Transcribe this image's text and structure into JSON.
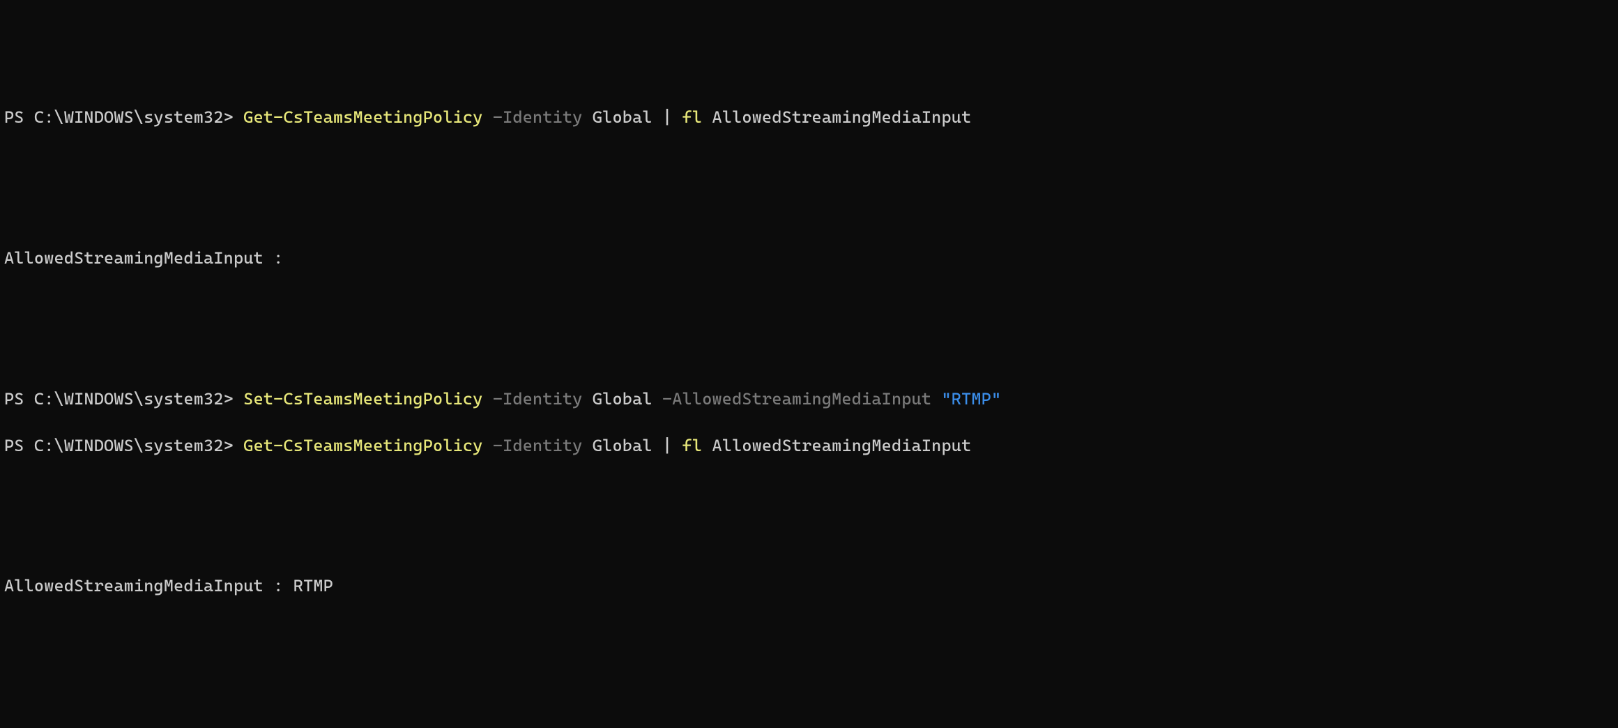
{
  "lines": {
    "l1": {
      "prompt": "PS C:\\WINDOWS\\system32> ",
      "cmdlet": "Get-CsTeamsMeetingPolicy",
      "param1": " -Identity",
      "arg1": " Global ",
      "pipe": "|",
      "fl": " fl ",
      "prop": "AllowedStreamingMediaInput"
    },
    "out1": "AllowedStreamingMediaInput :",
    "l2": {
      "prompt": "PS C:\\WINDOWS\\system32> ",
      "cmdlet": "Set-CsTeamsMeetingPolicy",
      "param1": " -Identity",
      "arg1": " Global",
      "param2": " -AllowedStreamingMediaInput ",
      "string": "\"RTMP\""
    },
    "l3": {
      "prompt": "PS C:\\WINDOWS\\system32> ",
      "cmdlet": "Get-CsTeamsMeetingPolicy",
      "param1": " -Identity",
      "arg1": " Global ",
      "pipe": "|",
      "fl": " fl ",
      "prop": "AllowedStreamingMediaInput"
    },
    "out2": "AllowedStreamingMediaInput : RTMP"
  }
}
